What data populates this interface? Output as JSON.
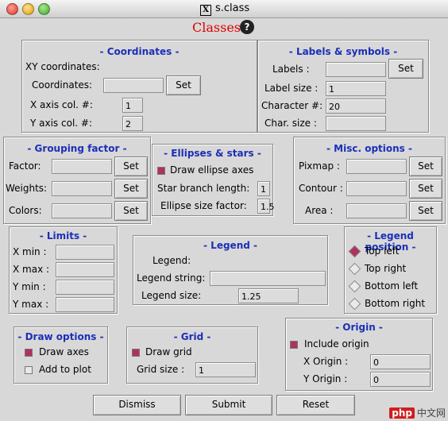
{
  "window": {
    "title": "s.class"
  },
  "heading": "Classes",
  "help_icon": "help-icon",
  "coordinates": {
    "title": "- Coordinates -",
    "xy_label": "XY coordinates:",
    "coords_label": "Coordinates:",
    "coords_value": "",
    "set_label": "Set",
    "xcol_label": "X axis col. #:",
    "xcol_value": "1",
    "ycol_label": "Y axis col. #:",
    "ycol_value": "2"
  },
  "labels_symbols": {
    "title": "- Labels & symbols -",
    "labels_label": "Labels :",
    "labels_value": "",
    "set_label": "Set",
    "label_size_label": "Label size :",
    "label_size_value": "1",
    "character_label": "Character #:",
    "character_value": "20",
    "char_size_label": "Char. size :",
    "char_size_value": ""
  },
  "grouping": {
    "title": "- Grouping factor -",
    "factor_label": "Factor:",
    "weights_label": "Weights:",
    "colors_label": "Colors:",
    "set_label": "Set"
  },
  "ellipses": {
    "title": "- Ellipses & stars -",
    "draw_ellipse_label": "Draw ellipse axes",
    "draw_ellipse_checked": true,
    "star_label": "Star branch length:",
    "star_value": "1",
    "ellipse_size_label": "Ellipse size factor:",
    "ellipse_size_value": "1.5"
  },
  "misc": {
    "title": "- Misc. options -",
    "pixmap_label": "Pixmap :",
    "contour_label": "Contour :",
    "area_label": "Area :",
    "set_label": "Set"
  },
  "limits": {
    "title": "- Limits -",
    "xmin_label": "X min :",
    "xmax_label": "X max :",
    "ymin_label": "Y min :",
    "ymax_label": "Y max :"
  },
  "legend": {
    "title": "- Legend -",
    "legend_label": "Legend:",
    "string_label": "Legend string:",
    "string_value": "",
    "size_label": "Legend size:",
    "size_value": "1.25"
  },
  "legend_position": {
    "title": "- Legend position -",
    "options": [
      "Top left",
      "Top right",
      "Bottom left",
      "Bottom right"
    ],
    "selected": "Top left"
  },
  "draw_options": {
    "title": "- Draw options -",
    "draw_axes_label": "Draw axes",
    "draw_axes_checked": true,
    "add_plot_label": "Add to plot",
    "add_plot_checked": false
  },
  "grid": {
    "title": "- Grid -",
    "draw_grid_label": "Draw grid",
    "draw_grid_checked": true,
    "grid_size_label": "Grid size :",
    "grid_size_value": "1"
  },
  "origin": {
    "title": "- Origin -",
    "include_label": "Include origin",
    "include_checked": true,
    "xorigin_label": "X Origin :",
    "xorigin_value": "0",
    "yorigin_label": "Y Origin :",
    "yorigin_value": "0"
  },
  "buttons": {
    "dismiss": "Dismiss",
    "submit": "Submit",
    "reset": "Reset"
  },
  "watermark": {
    "badge": "php",
    "text": "中文网"
  }
}
